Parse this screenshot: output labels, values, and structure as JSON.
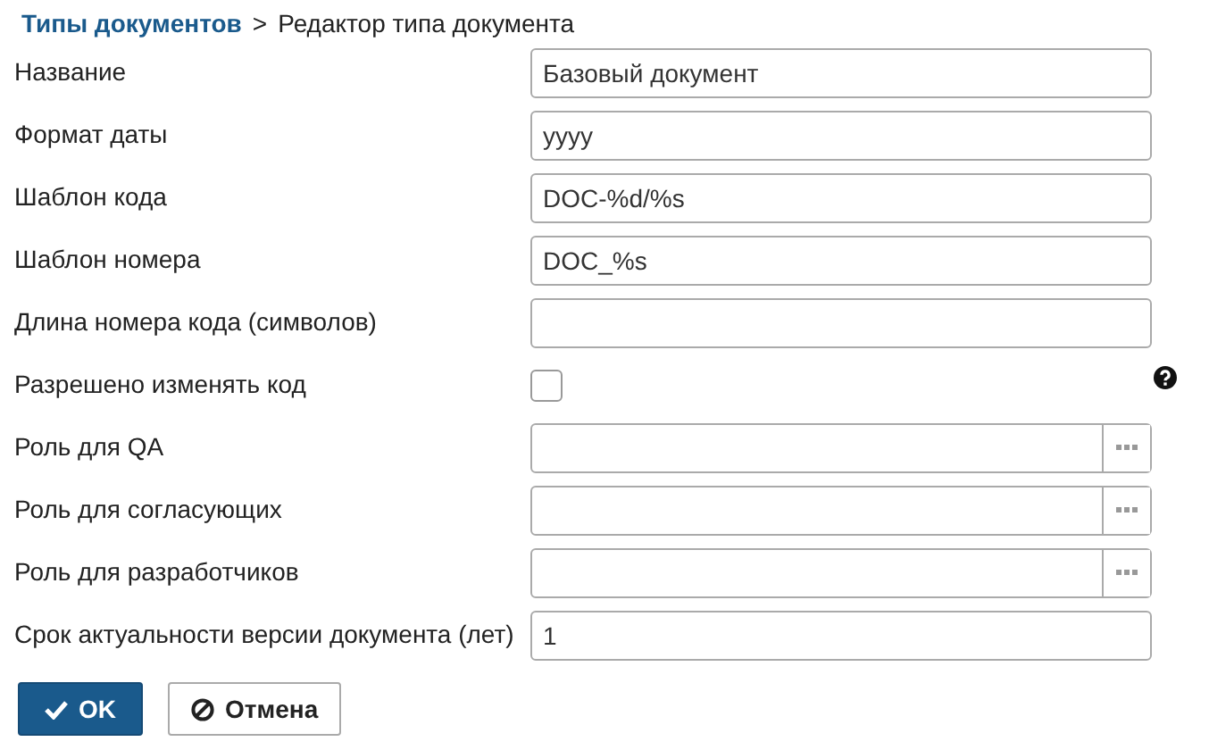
{
  "breadcrumb": {
    "parent": "Типы документов",
    "separator": ">",
    "current": "Редактор типа документа"
  },
  "fields": [
    {
      "kind": "text",
      "label": "Название",
      "value": "Базовый документ"
    },
    {
      "kind": "text",
      "label": "Формат даты",
      "value": "yyyy"
    },
    {
      "kind": "text",
      "label": "Шаблон кода",
      "value": "DOC-%d/%s"
    },
    {
      "kind": "text",
      "label": "Шаблон номера",
      "value": "DOC_%s"
    },
    {
      "kind": "text",
      "label": "Длина номера кода (символов)"
    },
    {
      "kind": "checkbox",
      "label": "Разрешено изменять код",
      "checked": false,
      "help": true
    },
    {
      "kind": "picker",
      "label": "Роль для QA"
    },
    {
      "kind": "picker",
      "label": "Роль для согласующих"
    },
    {
      "kind": "picker",
      "label": "Роль для разработчиков"
    },
    {
      "kind": "text",
      "label": "Срок актуальности версии документа (лет)",
      "value": "1"
    }
  ],
  "buttons": [
    {
      "kind": "primary",
      "label": "OK"
    },
    {
      "kind": "cancel",
      "label": "Отмена"
    }
  ]
}
